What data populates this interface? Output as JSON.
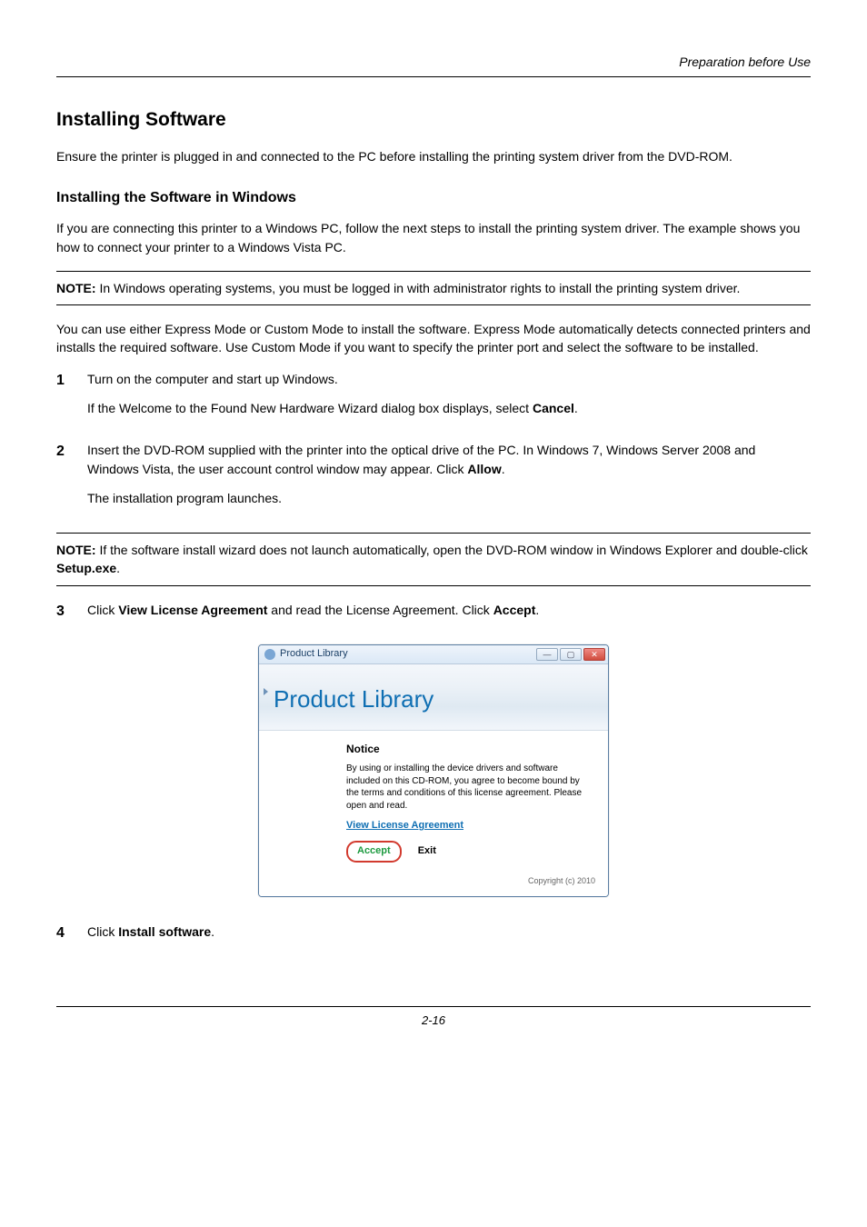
{
  "header": {
    "running": "Preparation before Use"
  },
  "title": "Installing Software",
  "intro": "Ensure the printer is plugged in and connected to the PC before installing the printing system driver from the DVD-ROM.",
  "subhead": "Installing the Software in Windows",
  "sub_intro": "If you are connecting this printer to a Windows PC, follow the next steps to install the printing system driver. The example shows you how to connect your printer to a Windows Vista PC.",
  "note1": {
    "label": "NOTE:",
    "text": " In Windows operating systems, you must be logged in with administrator rights to install the printing system driver."
  },
  "para_modes": "You can use either Express Mode or Custom Mode to install the software. Express Mode automatically detects connected printers and installs the required software. Use Custom Mode if you want to specify the printer port and select the software to be installed.",
  "steps": {
    "s1": {
      "num": "1",
      "p1": "Turn on the computer and start up Windows.",
      "p2a": "If the Welcome to the Found New Hardware Wizard dialog box displays, select ",
      "p2b": "Cancel",
      "p2c": "."
    },
    "s2": {
      "num": "2",
      "p1a": "Insert the DVD-ROM supplied with the printer into the optical drive of the PC. In Windows 7, Windows Server 2008 and Windows Vista, the user account control window may appear. Click ",
      "p1b": "Allow",
      "p1c": ".",
      "p2": "The installation program launches."
    },
    "s3": {
      "num": "3",
      "p1a": "Click ",
      "p1b": "View License Agreement",
      "p1c": " and read the License Agreement. Click ",
      "p1d": "Accept",
      "p1e": "."
    },
    "s4": {
      "num": "4",
      "p1a": "Click ",
      "p1b": "Install software",
      "p1c": "."
    }
  },
  "note2": {
    "label": "NOTE:",
    "text_a": " If the software install wizard does not launch automatically, open the DVD-ROM window in Windows Explorer and double-click ",
    "text_b": "Setup.exe",
    "text_c": "."
  },
  "dialog": {
    "window_title": "Product Library",
    "banner": "Product Library",
    "notice_heading": "Notice",
    "notice_body": "By using or installing the device drivers and software included on this CD-ROM, you agree to become bound by the terms and conditions of this license agreement. Please open and read.",
    "vla": "View License Agreement",
    "accept": "Accept",
    "exit": "Exit",
    "copyright": "Copyright (c) 2010"
  },
  "footer": {
    "page": "2-16"
  }
}
